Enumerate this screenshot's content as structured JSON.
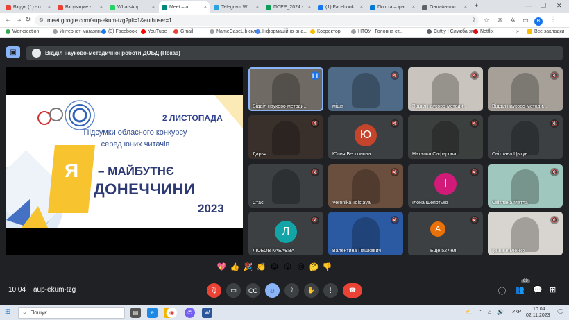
{
  "browser": {
    "tabs": [
      {
        "label": "Вхідні (1) - u...",
        "color": "#ea4335",
        "active": false
      },
      {
        "label": "Входящие -",
        "color": "#ea4335",
        "active": false
      },
      {
        "label": "WhatsApp",
        "color": "#25d366",
        "active": false
      },
      {
        "label": "Meet – a",
        "color": "#00897b",
        "active": true
      },
      {
        "label": "Telegram W...",
        "color": "#2aa3e0",
        "active": false
      },
      {
        "label": "ПСЕР_2024 -",
        "color": "#0f9d58",
        "active": false
      },
      {
        "label": "(1) Facebook",
        "color": "#1877f2",
        "active": false
      },
      {
        "label": "Пошта – іра...",
        "color": "#0078d4",
        "active": false
      },
      {
        "label": "Онлайн-шко...",
        "color": "#5f6368",
        "active": false
      }
    ],
    "new_tab": "+",
    "url": "meet.google.com/aup-ekum-tzg?pli=1&authuser=1",
    "profile_initial": "B",
    "bookmarks": [
      {
        "label": "Worksection",
        "color": "#34a853"
      },
      {
        "label": "Интернет-магазин...",
        "color": "#9aa0a6"
      },
      {
        "label": "(3) Facebook",
        "color": "#1877f2"
      },
      {
        "label": "YouTube",
        "color": "#ff0000"
      },
      {
        "label": "Gmail",
        "color": "#ea4335"
      },
      {
        "label": "NameCaseLib склo...",
        "color": "#9aa0a6"
      },
      {
        "label": "Інформаційно-ана...",
        "color": "#4285f4"
      },
      {
        "label": "Корректор",
        "color": "#fbbc04"
      },
      {
        "label": "НТОУ | Головна ст...",
        "color": "#9aa0a6"
      },
      {
        "label": "Cuttly | Служба зм...",
        "color": "#5f6368"
      },
      {
        "label": "Netflix",
        "color": "#e50914"
      }
    ],
    "all_bookmarks": "Все закладки"
  },
  "meet": {
    "meeting_title": "Відділ науково-методичної роботи ДОБД (Показ)",
    "slide": {
      "date": "2 ЛИСТОПАДА",
      "line1": "Підсумки обласного конкурсу",
      "line2": "серед юних читачів",
      "big_letter": "Я",
      "slogan1": "– МАЙБУТНЄ",
      "slogan2": "ДОНЕЧЧИНИ",
      "year": "2023"
    },
    "participants": [
      {
        "name": "Відділ науково-методи...",
        "initial": "",
        "bg": "#6f6a63",
        "avatar_color": "",
        "speaking": true
      },
      {
        "name": "міша",
        "initial": "",
        "bg": "#4f6a86",
        "avatar_color": "",
        "speaking": false
      },
      {
        "name": "Відділ науково-методи...",
        "initial": "",
        "bg": "#c9c4bd",
        "avatar_color": "",
        "speaking": false
      },
      {
        "name": "Відділ науково-методи...",
        "initial": "",
        "bg": "#a6a098",
        "avatar_color": "",
        "speaking": false
      },
      {
        "name": "Дарья",
        "initial": "",
        "bg": "#3a302b",
        "avatar_color": "",
        "speaking": false
      },
      {
        "name": "Юлия Бессонова",
        "initial": "Ю",
        "bg": "#3c4043",
        "avatar_color": "#c5442c",
        "speaking": false
      },
      {
        "name": "Наталья Сафарова",
        "initial": "",
        "bg": "#3b3f3e",
        "avatar_color": "",
        "speaking": false
      },
      {
        "name": "Світлана Цвігун",
        "initial": "",
        "bg": "#3c4043",
        "avatar_color": "",
        "speaking": false
      },
      {
        "name": "Стас",
        "initial": "",
        "bg": "#3c4043",
        "avatar_color": "",
        "speaking": false
      },
      {
        "name": "Veronika Tolstaya",
        "initial": "",
        "bg": "#6b4f3e",
        "avatar_color": "",
        "speaking": false
      },
      {
        "name": "Ілона Шепотько",
        "initial": "І",
        "bg": "#3c4043",
        "avatar_color": "#d21b79",
        "speaking": false
      },
      {
        "name": "Світлана Матла",
        "initial": "",
        "bg": "#9fc7bd",
        "avatar_color": "",
        "speaking": false
      },
      {
        "name": "ЛЮБОВ КАБАЄВА",
        "initial": "Л",
        "bg": "#3c4043",
        "avatar_color": "#12a4a7",
        "speaking": false
      },
      {
        "name": "Валентина Пашкевич",
        "initial": "",
        "bg": "#2b5aa3",
        "avatar_color": "",
        "speaking": false
      },
      {
        "name": "Ещё 52 чел.",
        "initial": "А",
        "bg": "#3c4043",
        "avatar_color": "#e8710a",
        "speaking": false
      },
      {
        "name": "Ірина Ільченко",
        "initial": "",
        "bg": "#d8d4cf",
        "avatar_color": "",
        "speaking": false
      }
    ],
    "reactions": [
      "💖",
      "👍",
      "🎉",
      "👏",
      "😂",
      "😮",
      "😢",
      "🤔",
      "👎"
    ],
    "clock": "10:04",
    "meeting_code": "aup-ekum-tzg",
    "participant_count": "69"
  },
  "taskbar": {
    "search_placeholder": "Пошук",
    "tray_lang": "УКР",
    "time": "10:04",
    "date": "02.11.2023"
  }
}
